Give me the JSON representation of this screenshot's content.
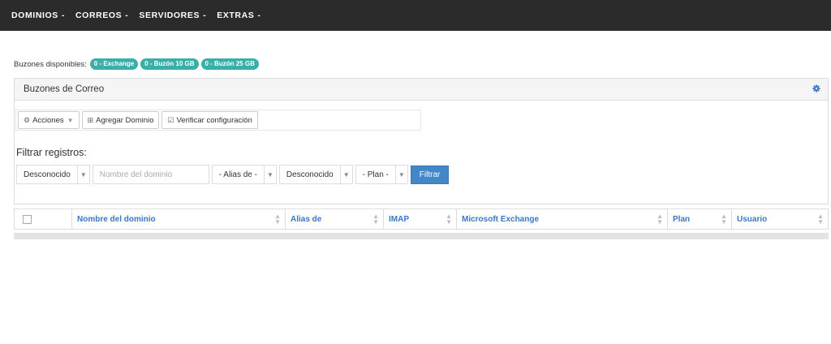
{
  "nav": {
    "items": [
      {
        "label": "DOMINIOS",
        "caret": "-"
      },
      {
        "label": "CORREOS",
        "caret": "-"
      },
      {
        "label": "SERVIDORES",
        "caret": "-"
      },
      {
        "label": "EXTRAS",
        "caret": "-"
      }
    ]
  },
  "available": {
    "label": "Buzones disponibles:",
    "badges": [
      "0 - Exchange",
      "0 - Buzón 10 GB",
      "0 - Buzón 25 GB"
    ],
    "badge_color": "#3aafa9"
  },
  "panel": {
    "title": "Buzones de Correo",
    "settings_icon": "gear-icon",
    "toolbar": {
      "actions_label": "Acciones",
      "add_domain_label": "Agregar Dominio",
      "verify_label": "Verificar configuración"
    },
    "filter": {
      "label": "Filtrar registros:",
      "status1_value": "Desconocido",
      "domain_placeholder": "Nombre del dominio",
      "alias_value": "- Alias de -",
      "status2_value": "Desconocido",
      "plan_value": "- Plan -",
      "submit_label": "Filtrar"
    }
  },
  "table": {
    "columns": [
      "Nombre del dominio",
      "Alias de",
      "IMAP",
      "Microsoft Exchange",
      "Plan",
      "Usuario"
    ],
    "rows": []
  },
  "colors": {
    "nav_bg": "#2b2b2b",
    "accent": "#4287c8",
    "link": "#3a78c3"
  }
}
